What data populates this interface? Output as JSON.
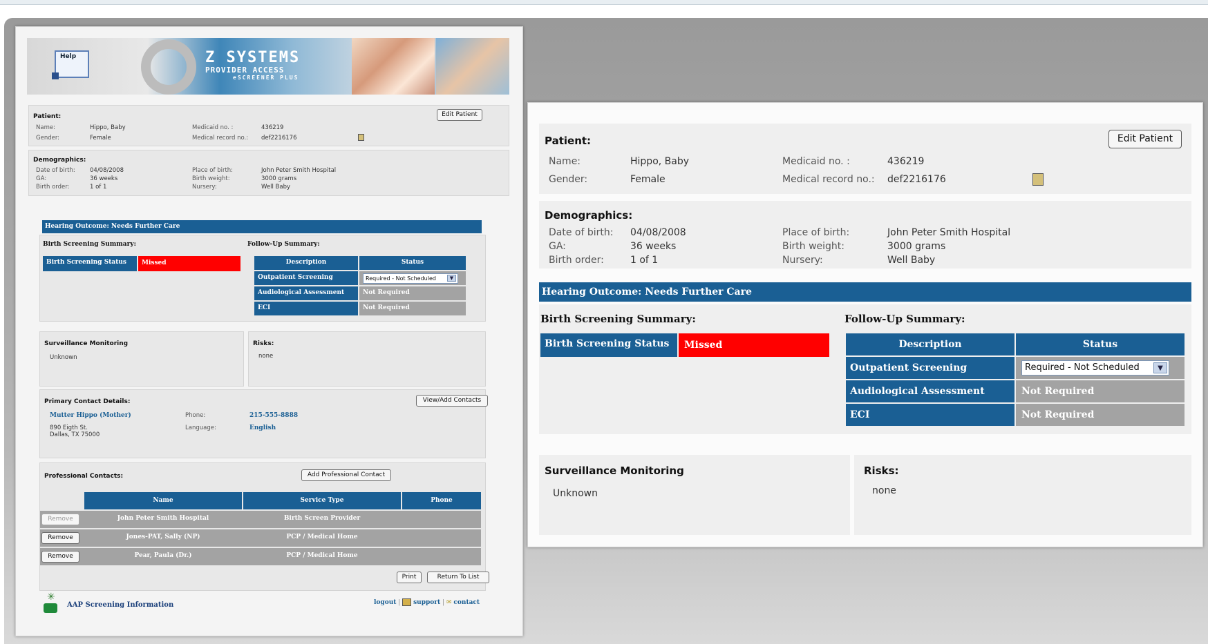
{
  "header": {
    "help_label": "Help",
    "logo_brand": "Z SYSTEMS",
    "logo_sub": "PROVIDER ACCESS",
    "logo_product": "eSCREENER PLUS"
  },
  "patient": {
    "section_label": "Patient:",
    "edit_button": "Edit Patient",
    "name_key": "Name:",
    "name_value": "Hippo, Baby",
    "gender_key": "Gender:",
    "gender_value": "Female",
    "medicaid_key": "Medicaid no. :",
    "medicaid_value": "436219",
    "mrn_key": "Medical record no.:",
    "mrn_value": "def2216176"
  },
  "demographics": {
    "section_label": "Demographics:",
    "dob_key": "Date of birth:",
    "dob_value": "04/08/2008",
    "ga_key": "GA:",
    "ga_value": "36 weeks",
    "order_key": "Birth order:",
    "order_value": "1 of 1",
    "pob_key": "Place of birth:",
    "pob_value": "John Peter Smith Hospital",
    "weight_key": "Birth weight:",
    "weight_value": "3000 grams",
    "nursery_key": "Nursery:",
    "nursery_value": "Well Baby"
  },
  "outcome": {
    "bar_text": "Hearing Outcome: Needs Further Care"
  },
  "birth_screening": {
    "section_label": "Birth Screening Summary:",
    "status_key": "Birth Screening Status",
    "status_value": "Missed"
  },
  "follow_up": {
    "section_label": "Follow-Up Summary:",
    "col_description": "Description",
    "col_status": "Status",
    "rows": [
      {
        "description": "Outpatient Screening",
        "status": "Required - Not Scheduled"
      },
      {
        "description": "Audiological Assessment",
        "status": "Not Required"
      },
      {
        "description": "ECI",
        "status": "Not Required"
      }
    ]
  },
  "surveillance": {
    "section_label": "Surveillance Monitoring",
    "value": "Unknown"
  },
  "risks": {
    "section_label": "Risks:",
    "value": "none"
  },
  "primary_contact": {
    "section_label": "Primary Contact Details:",
    "view_button": "View/Add Contacts",
    "name": "Mutter Hippo (Mother)",
    "address_line1": "890 Eigth St.",
    "address_line2": "Dallas, TX 75000",
    "phone_key": "Phone:",
    "phone_value": "215-555-8888",
    "language_key": "Language:",
    "language_value": "English"
  },
  "professional_contacts": {
    "section_label": "Professional Contacts:",
    "add_button": "Add Professional Contact",
    "col_name": "Name",
    "col_service": "Service Type",
    "col_phone": "Phone",
    "remove_label": "Remove",
    "rows": [
      {
        "name": "John Peter Smith Hospital",
        "service": "Birth Screen Provider",
        "phone": ""
      },
      {
        "name": "Jones-PAT, Sally (NP)",
        "service": "PCP / Medical Home",
        "phone": ""
      },
      {
        "name": "Pear, Paula (Dr.)",
        "service": "PCP / Medical Home",
        "phone": ""
      }
    ]
  },
  "footer": {
    "print_button": "Print",
    "return_button": "Return To List",
    "aap_label": "AAP Screening Information",
    "logout": "logout",
    "support": "support",
    "contact": "contact",
    "sep": "|"
  },
  "colors": {
    "accent_blue": "#1a5f94",
    "missed_red": "#ff0000",
    "gray_cell": "#a3a3a3"
  }
}
